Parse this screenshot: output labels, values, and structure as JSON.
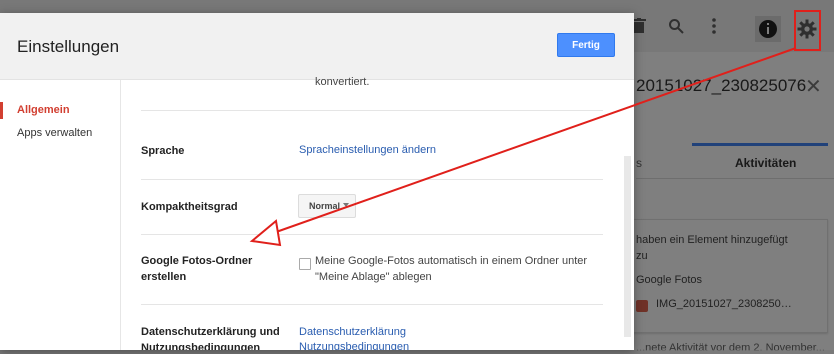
{
  "background": {
    "title": "20151027_230825076",
    "tab_partial": "s",
    "tab_activities": "Aktivitäten",
    "activity_text": "haben ein Element hinzugefügt zu",
    "activity_source": "Google Fotos",
    "activity_file": "IMG_20151027_2308250…",
    "footer_text": "...nete Aktivität vor dem 2. November...",
    "icons": [
      "trash-icon",
      "search-icon",
      "more-vert-icon",
      "info-icon",
      "gear-icon",
      "close-icon"
    ]
  },
  "dialog": {
    "title": "Einstellungen",
    "done_label": "Fertig",
    "nav": {
      "general": "Allgemein",
      "apps": "Apps verwalten"
    },
    "converted_text": "konvertiert.",
    "language": {
      "label": "Sprache",
      "link": "Spracheinstellungen ändern"
    },
    "density": {
      "label": "Kompaktheitsgrad",
      "value": "Normal"
    },
    "photos_folder": {
      "label_line1": "Google Fotos-Ordner",
      "label_line2": "erstellen",
      "desc_line1": "Meine Google-Fotos automatisch in einem Ordner unter",
      "desc_line2": "\"Meine Ablage\" ablegen",
      "checked": false
    },
    "privacy": {
      "label_line1": "Datenschutzerklärung und",
      "label_line2": "Nutzungsbedingungen",
      "link1": "Datenschutzerklärung",
      "link2": "Nutzungsbedingungen"
    }
  },
  "colors": {
    "accent_blue": "#4d90fe",
    "nav_active": "#d23f31",
    "annotation_red": "#e0201b",
    "link": "#2a5db0"
  }
}
